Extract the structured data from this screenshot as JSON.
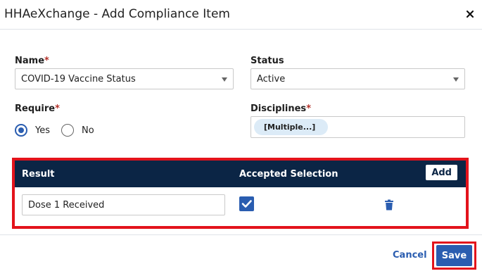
{
  "dialog": {
    "title": "HHAeXchange - Add Compliance Item"
  },
  "form": {
    "name": {
      "label": "Name",
      "required_mark": "*",
      "value": "COVID-19 Vaccine Status"
    },
    "status": {
      "label": "Status",
      "value": "Active"
    },
    "require": {
      "label": "Require",
      "required_mark": "*",
      "options": [
        "Yes",
        "No"
      ],
      "selected": "Yes"
    },
    "disciplines": {
      "label": "Disciplines",
      "required_mark": "*",
      "chip": "[Multiple...]"
    }
  },
  "table": {
    "columns": {
      "result": "Result",
      "accepted": "Accepted Selection"
    },
    "add_label": "Add",
    "rows": [
      {
        "result": "Dose 1 Received",
        "accepted": true
      }
    ]
  },
  "footer": {
    "cancel_label": "Cancel",
    "save_label": "Save"
  },
  "colors": {
    "primary": "#2a5db0",
    "header_bg": "#0b2545",
    "highlight": "#e3131b",
    "required": "#b4322a"
  },
  "icons": {
    "close": "close-icon",
    "dropdown": "chevron-down-icon",
    "check": "check-icon",
    "delete": "trash-icon"
  }
}
